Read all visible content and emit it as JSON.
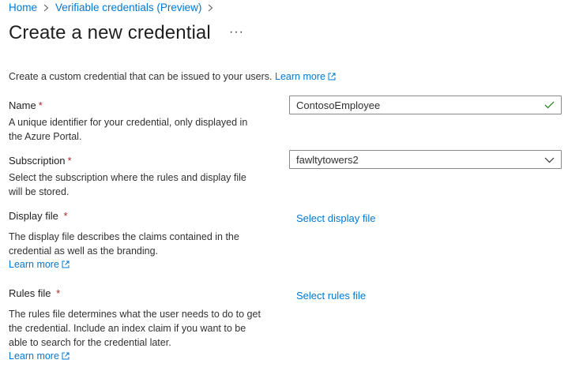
{
  "breadcrumb": {
    "items": [
      "Home",
      "Verifiable credentials (Preview)"
    ]
  },
  "page": {
    "title": "Create a new credential",
    "more_label": "···"
  },
  "intro": {
    "text": "Create a custom credential that can be issued to your users.",
    "learn_more": "Learn more"
  },
  "form": {
    "name": {
      "label": "Name",
      "required_mark": "*",
      "description": "A unique identifier for your credential, only displayed in the Azure Portal.",
      "value": "ContosoEmployee",
      "valid": true
    },
    "subscription": {
      "label": "Subscription",
      "required_mark": "*",
      "description": "Select the subscription where the rules and display file will be stored.",
      "selected": "fawltytowers2"
    },
    "display_file": {
      "label": "Display file",
      "required_mark": "*",
      "description": "The display file describes the claims contained in the credential as well as the branding.",
      "learn_more": "Learn more",
      "action": "Select display file"
    },
    "rules_file": {
      "label": "Rules file",
      "required_mark": "*",
      "description": "The rules file determines what the user needs to do to get the credential. Include an index claim if you want to be able to search for the credential later.",
      "learn_more": "Learn more",
      "action": "Select rules file"
    }
  },
  "colors": {
    "link": "#0078d4",
    "required": "#a4262c",
    "valid_check": "#107c10",
    "border": "#8a8886"
  }
}
